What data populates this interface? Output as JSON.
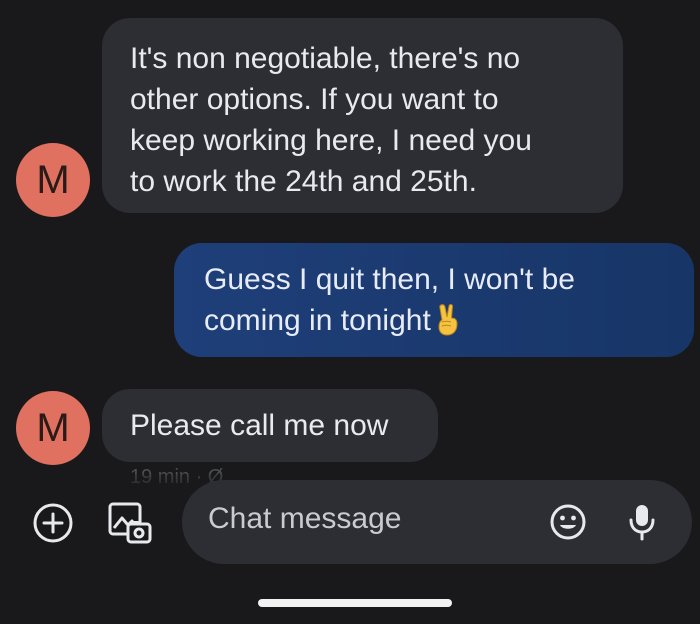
{
  "conversation": {
    "messages": [
      {
        "direction": "incoming",
        "avatar_letter": "M",
        "lines": [
          "It's non negotiable, there's no",
          "other options. If you want to",
          "keep working here, I need you",
          "to work the 24th and 25th."
        ]
      },
      {
        "direction": "outgoing",
        "lines": [
          "Guess I quit then, I won't be",
          "coming in tonight"
        ],
        "emoji": "victory-hand-emoji"
      },
      {
        "direction": "incoming",
        "avatar_letter": "M",
        "lines": [
          "Please call me now"
        ],
        "timestamp": "19 min · Ø"
      }
    ]
  },
  "composer": {
    "placeholder": "Chat message",
    "icons": {
      "add": "add-circle-icon",
      "gallery": "gallery-icon",
      "emoji": "emoji-icon",
      "mic": "microphone-icon"
    }
  },
  "colors": {
    "background": "#19191c",
    "incoming_bubble": "#2c2e33",
    "outgoing_bubble": "#1f3f7a",
    "avatar": "#e0705f"
  }
}
